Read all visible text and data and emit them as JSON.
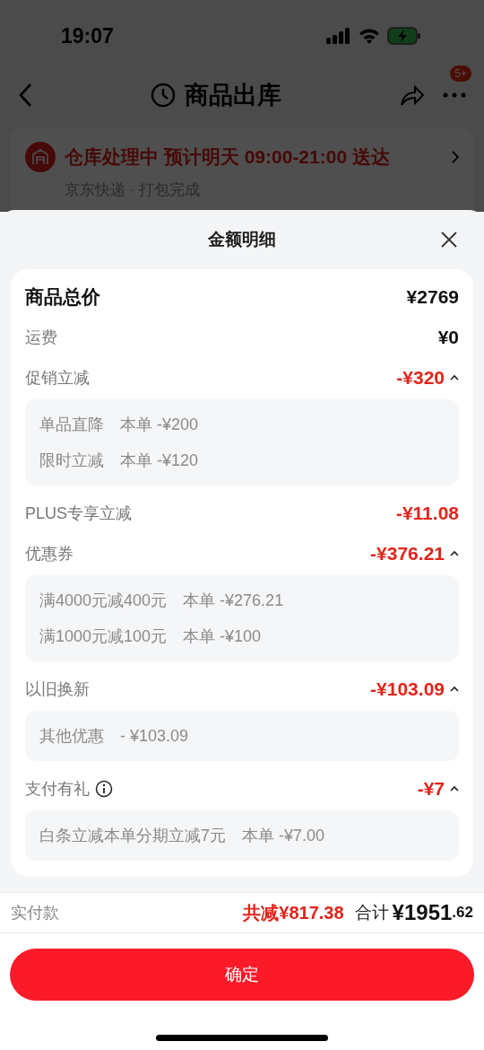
{
  "status_bar": {
    "time": "19:07"
  },
  "nav": {
    "title": "商品出库",
    "badge": "5+"
  },
  "order_card": {
    "status": "仓库处理中 预计明天 09:00-21:00 送达",
    "progress": "京东快递 · 打包完成"
  },
  "sheet": {
    "title": "金额明细",
    "items": [
      {
        "kind": "total",
        "label": "商品总价",
        "amount": "¥2769"
      },
      {
        "kind": "plain",
        "label": "运费",
        "amount": "¥0"
      },
      {
        "kind": "discount",
        "label": "促销立减",
        "amount": "-¥320",
        "expanded": true,
        "details": [
          {
            "name": "单品直降",
            "value": "本单 -¥200"
          },
          {
            "name": "限时立减",
            "value": "本单 -¥120"
          }
        ]
      },
      {
        "kind": "discount",
        "label": "PLUS专享立减",
        "amount": "-¥11.08"
      },
      {
        "kind": "discount",
        "label": "优惠券",
        "amount": "-¥376.21",
        "expanded": true,
        "details": [
          {
            "name": "满4000元减400元",
            "value": "本单 -¥276.21"
          },
          {
            "name": "满1000元减100元",
            "value": "本单 -¥100"
          }
        ]
      },
      {
        "kind": "discount",
        "label": "以旧换新",
        "amount": "-¥103.09",
        "expanded": true,
        "details": [
          {
            "name": "其他优惠",
            "value": "- ¥103.09"
          }
        ]
      },
      {
        "kind": "discount",
        "label": "支付有礼",
        "info": true,
        "amount": "-¥7",
        "expanded": true,
        "details": [
          {
            "name": "白条立减本单分期立减7元",
            "value": "本单 -¥7.00"
          }
        ]
      }
    ]
  },
  "footer": {
    "label": "实付款",
    "saving": "共减¥817.38",
    "total_label": "合计",
    "total_integer": "¥1951",
    "total_decimal": ".62"
  },
  "confirm_button": "确定"
}
